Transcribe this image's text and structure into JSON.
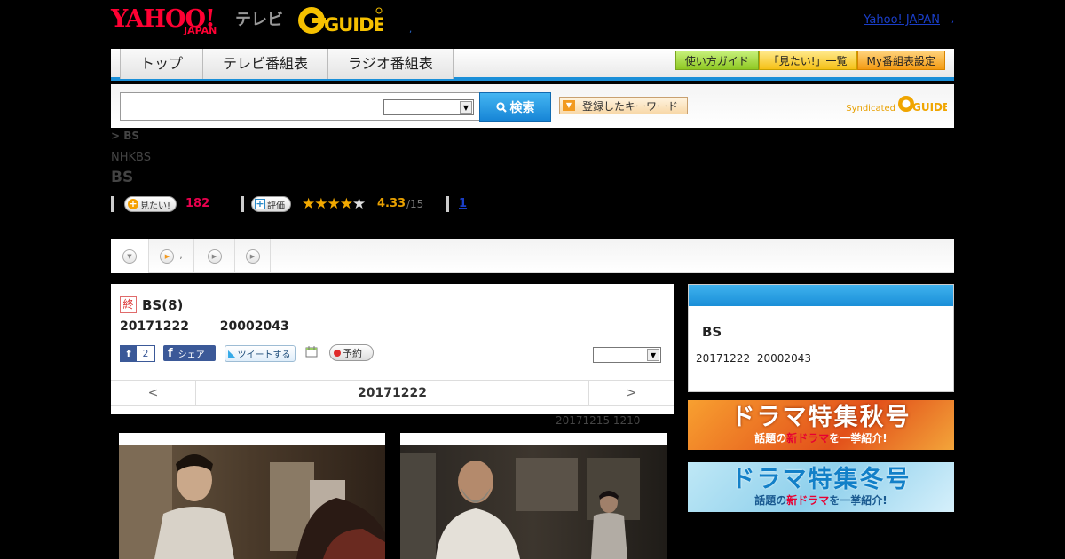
{
  "header": {
    "logo_yahoo": "YAHOO!",
    "logo_japan": "JAPAN",
    "logo_tv": "テレビ",
    "logo_gguide": "G-GUIDE",
    "sep_dot": ",",
    "yahoo_japan_link": "Yahoo! JAPAN",
    "yahoo_japan_dot": ","
  },
  "nav": {
    "tabs": [
      "トップ",
      "テレビ番組表",
      "ラジオ番組表"
    ],
    "buttons": [
      "使い方ガイド",
      "「見たい!」一覧",
      "My番組表設定"
    ]
  },
  "search": {
    "input_value": "",
    "select_value": "",
    "search_label": "検索",
    "keyword_label": "登録したキーワード",
    "syndicated_label": "Syndicated",
    "gguide_label": "G-GUIDE"
  },
  "breadcrumb": "> BS",
  "channel": "NHKBS",
  "program_title": "BS",
  "stats": {
    "want_label": "見たい!",
    "want_count": "182",
    "rate_label": "評価",
    "stars_filled": "★★★★",
    "stars_empty": "★",
    "score": "4.33",
    "score_count": "/15",
    "review_link": "1"
  },
  "subtabs": {
    "tab2_dot": ","
  },
  "episode": {
    "end_badge": "終",
    "title": "BS(8)",
    "dates": "20171222 20002043",
    "fb_icon": "f",
    "fb_count": "2",
    "fb_share": "シェア",
    "tweet": "ツイートする",
    "reserve": "予約",
    "select_value": "",
    "prev": "<",
    "current": "20171222",
    "next": ">",
    "updated": "20171215  1210"
  },
  "side": {
    "title": "BS",
    "date": "20171222 20002043"
  },
  "banners": {
    "autumn_big": "ドラマ特集秋号",
    "winter_big": "ドラマ特集冬号",
    "sub_pre": "話題の",
    "sub_red": "新ドラマ",
    "sub_post": "を一挙紹介!"
  },
  "colors": {
    "accent_blue": "#1a8fd8",
    "want_red": "#e8004d",
    "star_gold": "#f2a900",
    "brand_red": "#ff0033"
  }
}
